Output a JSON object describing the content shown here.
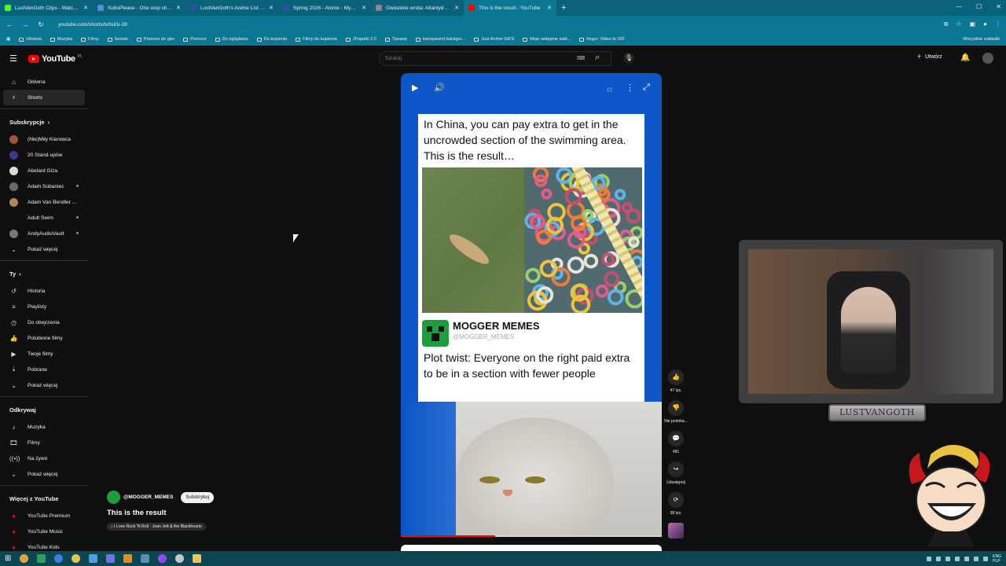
{
  "browser": {
    "tabs": [
      {
        "title": "LustVanGoth Clips - Watch Live",
        "color": "#53fc18"
      },
      {
        "title": "SubsPlease - One stop shop fo",
        "color": "#5a8dd8"
      },
      {
        "title": "LustVanGoth's Anime List - My",
        "color": "#2e51a2"
      },
      {
        "title": "Spring 2026 - Anime - MyAnim",
        "color": "#2e51a2"
      },
      {
        "title": "Gwiezdne wrota: Atlantyda / St",
        "color": "#888888"
      },
      {
        "title": "This is the result - YouTube",
        "color": "#ff0000"
      }
    ],
    "url": "youtube.com/shorts/tv0sil1i-28",
    "bookmarks": [
      "Ubrania",
      "Muzyka",
      "Filmy",
      "Seriale",
      "Pomoce do gier",
      "Pomoce",
      "Do oglądania",
      "Do kupienia",
      "Filmy do kupienia",
      "JFopulki 2.0",
      "Tpeaep",
      "transparent backgro...",
      "Just Anime GIFS",
      "Moje wstępnie zakł...",
      "Imgur: Video to GIF"
    ],
    "bookmarks_right": "Wszystkie zakładki"
  },
  "youtube": {
    "logo_text": "YouTube",
    "country": "PL",
    "search_placeholder": "Szukaj",
    "create_label": "Utwórz"
  },
  "sidebar": {
    "main": [
      {
        "label": "Główna",
        "icon": "home-icon"
      },
      {
        "label": "Shorts",
        "icon": "shorts-icon"
      }
    ],
    "subscriptions_title": "Subskrypcje",
    "subscriptions": [
      {
        "label": "(Nie)Miły Kierowca",
        "color": "#a0562e",
        "dot": false
      },
      {
        "label": "20 Stand-upów",
        "color": "#3a3a8a",
        "dot": false
      },
      {
        "label": "Abelard Giza",
        "color": "#d9d9d9",
        "dot": false
      },
      {
        "label": "Adam Sobaniec",
        "color": "#6a6a6a",
        "dot": true
      },
      {
        "label": "Adam Van Bendler ...",
        "color": "#b08950",
        "dot": false
      },
      {
        "label": "Adult Swim",
        "color": "#111111",
        "dot": true
      },
      {
        "label": "AndyAudioVault",
        "color": "#777777",
        "dot": true
      }
    ],
    "show_more_1": "Pokaż więcej",
    "you_title": "Ty",
    "you": [
      {
        "label": "Historia",
        "icon": "history-icon"
      },
      {
        "label": "Playlisty",
        "icon": "playlist-icon"
      },
      {
        "label": "Do obejrzenia",
        "icon": "watch-later-icon"
      },
      {
        "label": "Polubione filmy",
        "icon": "like-icon"
      },
      {
        "label": "Twoje filmy",
        "icon": "your-videos-icon"
      },
      {
        "label": "Pobrane",
        "icon": "download-icon"
      }
    ],
    "show_more_2": "Pokaż więcej",
    "explore_title": "Odkrywaj",
    "explore": [
      {
        "label": "Muzyka",
        "icon": "music-icon"
      },
      {
        "label": "Filmy",
        "icon": "film-icon"
      },
      {
        "label": "Na żywo",
        "icon": "live-icon"
      }
    ],
    "show_more_3": "Pokaż więcej",
    "more_title": "Więcej z YouTube",
    "more": [
      {
        "label": "YouTube Premium"
      },
      {
        "label": "YouTube Music"
      },
      {
        "label": "YouTube Kids"
      }
    ]
  },
  "short": {
    "caption_top": "In China, you can pay extra to get in the uncrowded section of the swimming area. This is the result…",
    "meme_account": "MOGGER MEMES",
    "meme_handle": "@MOGGER_MEMES",
    "caption_bottom": "Plot twist: Everyone on the right paid extra to be in a section with fewer people",
    "progress": 0.36,
    "channel": "@MOGGER_MEMES",
    "subscribe_label": "Subskrybuj",
    "title": "This is the result",
    "music": "I Love Rock 'N Roll · Joan Jett & the Blackhearts"
  },
  "actions": [
    {
      "label": "47 tys.",
      "icon": "thumbs-up-icon"
    },
    {
      "label": "Nie podoba...",
      "icon": "thumbs-down-icon"
    },
    {
      "label": "481",
      "icon": "comment-icon"
    },
    {
      "label": "Udostępnij",
      "icon": "share-icon"
    },
    {
      "label": "38 tys.",
      "icon": "remix-icon"
    }
  ],
  "overlay": {
    "nameplate": "LUSTVANGOTH"
  },
  "taskbar": {
    "lang_top": "ENG",
    "lang_bottom": "PLP"
  }
}
